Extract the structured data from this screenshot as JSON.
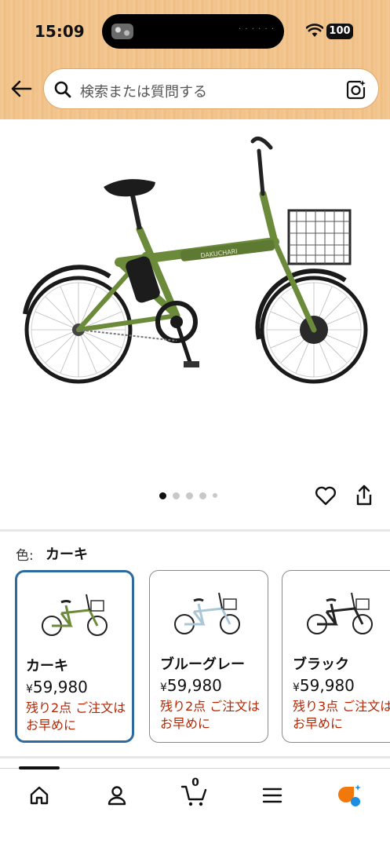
{
  "status_bar": {
    "time": "15:09",
    "battery": "100"
  },
  "search": {
    "placeholder": "検索または質問する"
  },
  "carousel": {
    "total_images": 5,
    "active_index": 0
  },
  "variant": {
    "label": "色:",
    "selected": "カーキ",
    "options": [
      {
        "name": "カーキ",
        "currency": "¥",
        "price": "59,980",
        "stock": "残り2点 ご注文はお早めに",
        "frame_color": "#6b8a3a",
        "selected": true
      },
      {
        "name": "ブルーグレー",
        "currency": "¥",
        "price": "59,980",
        "stock": "残り2点 ご注文はお早めに",
        "frame_color": "#a9c7d6",
        "selected": false
      },
      {
        "name": "ブラック",
        "currency": "¥",
        "price": "59,980",
        "stock": "残り3点 ご注文はお早めに",
        "frame_color": "#222222",
        "selected": false
      }
    ]
  },
  "product_image": {
    "brand_text": "DAKUCHARI",
    "frame_color": "#6b8a3a"
  },
  "bottom_nav": {
    "cart_count": "0"
  },
  "colors": {
    "accent_blue": "#2c6aa0",
    "stock_red": "#b12704",
    "alexa_orange": "#f2780c",
    "alexa_blue": "#1a8fe3"
  }
}
